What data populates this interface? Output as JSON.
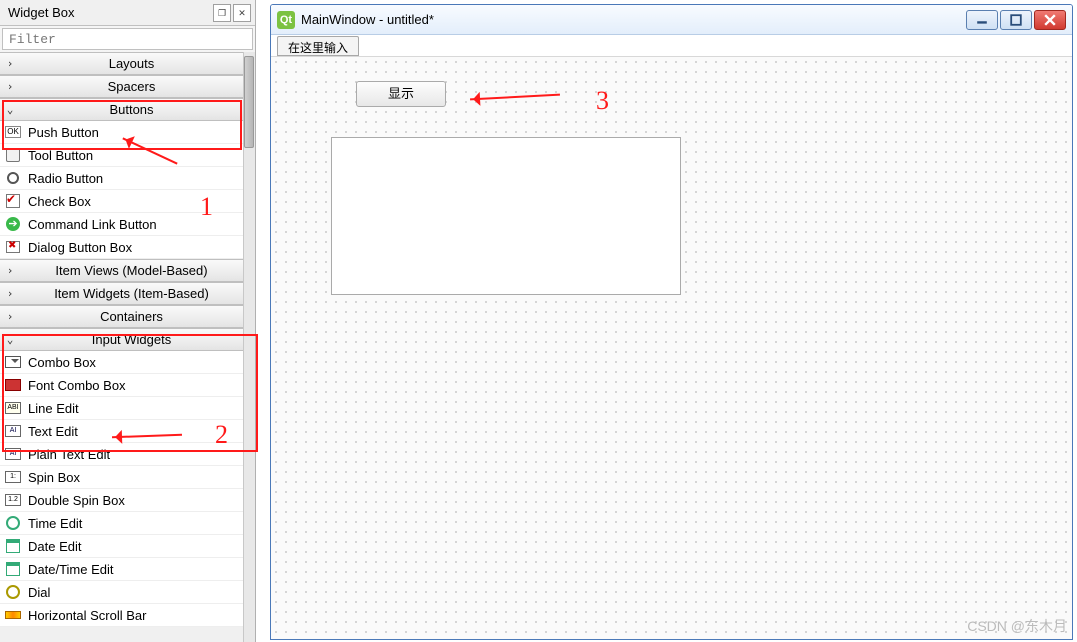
{
  "dock": {
    "title": "Widget Box",
    "float_btn": "❐",
    "close_btn": "✕",
    "filter_placeholder": "Filter"
  },
  "categories": {
    "layouts": {
      "label": "Layouts",
      "expanded": false
    },
    "spacers": {
      "label": "Spacers",
      "expanded": false
    },
    "buttons": {
      "label": "Buttons",
      "expanded": true
    },
    "views": {
      "label": "Item Views (Model-Based)",
      "expanded": false
    },
    "item_widgets": {
      "label": "Item Widgets (Item-Based)",
      "expanded": false
    },
    "containers": {
      "label": "Containers",
      "expanded": false
    },
    "input": {
      "label": "Input Widgets",
      "expanded": true
    }
  },
  "buttons_items": [
    {
      "label": "Push Button",
      "icon": "ok"
    },
    {
      "label": "Tool Button",
      "icon": "tool"
    },
    {
      "label": "Radio Button",
      "icon": "radio"
    },
    {
      "label": "Check Box",
      "icon": "check"
    },
    {
      "label": "Command Link Button",
      "icon": "cmd"
    },
    {
      "label": "Dialog Button Box",
      "icon": "dlg"
    }
  ],
  "input_items": [
    {
      "label": "Combo Box",
      "icon": "combo"
    },
    {
      "label": "Font Combo Box",
      "icon": "font"
    },
    {
      "label": "Line Edit",
      "icon": "line"
    },
    {
      "label": "Text Edit",
      "icon": "text"
    },
    {
      "label": "Plain Text Edit",
      "icon": "text"
    },
    {
      "label": "Spin Box",
      "icon": "spin"
    },
    {
      "label": "Double Spin Box",
      "icon": "spin"
    },
    {
      "label": "Time Edit",
      "icon": "time"
    },
    {
      "label": "Date Edit",
      "icon": "date"
    },
    {
      "label": "Date/Time Edit",
      "icon": "date"
    },
    {
      "label": "Dial",
      "icon": "dial"
    },
    {
      "label": "Horizontal Scroll Bar",
      "icon": "hscroll"
    }
  ],
  "window": {
    "logo_text": "Qt",
    "title": "MainWindow - untitled*",
    "menu_item": "在这里输入",
    "button_label": "显示"
  },
  "annotations": {
    "one": "1",
    "two": "2",
    "three": "3"
  },
  "watermark": "CSDN @东木月"
}
